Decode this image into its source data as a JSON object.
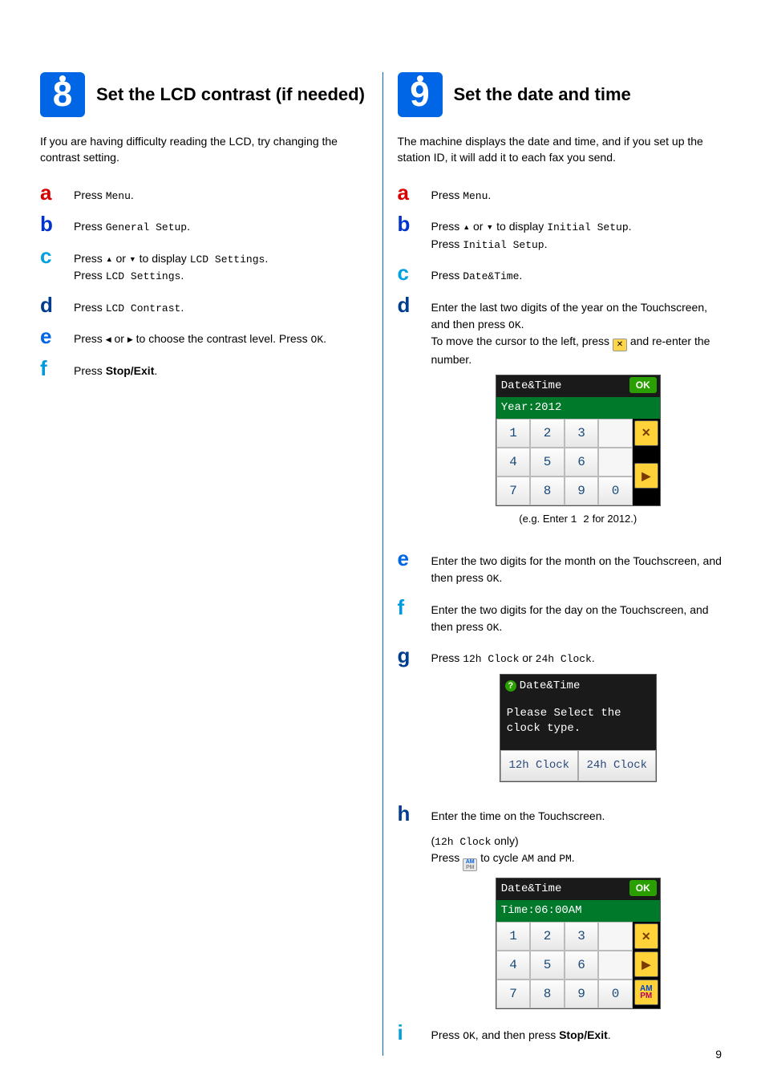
{
  "page_number": "9",
  "left": {
    "badge": "8",
    "title": "Set the LCD contrast (if needed)",
    "intro": "If you are having difficulty reading the LCD, try changing the contrast setting.",
    "steps": {
      "a": {
        "t1": "Press ",
        "m1": "Menu",
        "t2": "."
      },
      "b": {
        "t1": "Press ",
        "m1": "General Setup",
        "t2": "."
      },
      "c": {
        "t1": "Press ",
        "t2": " or ",
        "t3": " to display ",
        "m1": "LCD Settings",
        "t4": ".",
        "t5": "Press ",
        "m2": "LCD Settings",
        "t6": "."
      },
      "d": {
        "t1": "Press ",
        "m1": "LCD Contrast",
        "t2": "."
      },
      "e": {
        "t1": "Press ",
        "t2": " or ",
        "t3": " to choose the contrast level. Press ",
        "m1": "OK",
        "t4": "."
      },
      "f": {
        "t1": "Press ",
        "b1": "Stop/Exit",
        "t2": "."
      }
    }
  },
  "right": {
    "badge": "9",
    "title": "Set the date and time",
    "intro": "The machine displays the date and time, and if you set up the station ID, it will add it to each fax you send.",
    "steps": {
      "a": {
        "t1": "Press ",
        "m1": "Menu",
        "t2": "."
      },
      "b": {
        "t1": "Press ",
        "t2": " or ",
        "t3": " to display ",
        "m1": "Initial Setup",
        "t4": ".",
        "t5": "Press ",
        "m2": "Initial Setup",
        "t6": "."
      },
      "c": {
        "t1": "Press ",
        "m1": "Date&Time",
        "t2": "."
      },
      "d": {
        "t1": "Enter the last two digits of the year on the Touchscreen, and then press ",
        "m1": "OK",
        "t2": ".",
        "t3": "To move the cursor to the left, press ",
        "t4": " and re-enter the number."
      },
      "e": {
        "t1": "Enter the two digits for the month on the Touchscreen, and then press ",
        "m1": "OK",
        "t2": "."
      },
      "f": {
        "t1": "Enter the two digits for the day on the Touchscreen, and then press ",
        "m1": "OK",
        "t2": "."
      },
      "g": {
        "t1": "Press ",
        "m1": "12h Clock",
        "t2": " or ",
        "m2": "24h Clock",
        "t3": "."
      },
      "h": {
        "t1": "Enter the time on the Touchscreen.",
        "t2": "(",
        "m1": "12h Clock",
        "t3": " only)",
        "t4": "Press ",
        "t5": " to cycle ",
        "m2": "AM",
        "t6": " and ",
        "m3": "PM",
        "t7": "."
      },
      "i": {
        "t1": "Press ",
        "m1": "OK",
        "t2": ", and then press ",
        "b1": "Stop/Exit",
        "t3": "."
      }
    },
    "lcd1": {
      "title": "Date&Time",
      "ok": "OK",
      "sub": "Year:2012",
      "keys": [
        [
          "1",
          "2",
          "3",
          ""
        ],
        [
          "4",
          "5",
          "6",
          ""
        ],
        [
          "7",
          "8",
          "9",
          "0"
        ]
      ],
      "side": {
        "x": "✕",
        "r": "▶"
      },
      "caption_a": "(e.g. Enter ",
      "caption_m": "1 2",
      "caption_b": " for 2012.)"
    },
    "lcd2": {
      "title": "Date&Time",
      "msg": "Please Select the clock type.",
      "btn1": "12h Clock",
      "btn2": "24h Clock"
    },
    "lcd3": {
      "title": "Date&Time",
      "ok": "OK",
      "sub": "Time:06:00AM",
      "keys": [
        [
          "1",
          "2",
          "3",
          ""
        ],
        [
          "4",
          "5",
          "6",
          ""
        ],
        [
          "7",
          "8",
          "9",
          "0"
        ]
      ],
      "side": {
        "x": "✕",
        "r": "▶",
        "am": "AM",
        "pm": "PM"
      }
    }
  }
}
